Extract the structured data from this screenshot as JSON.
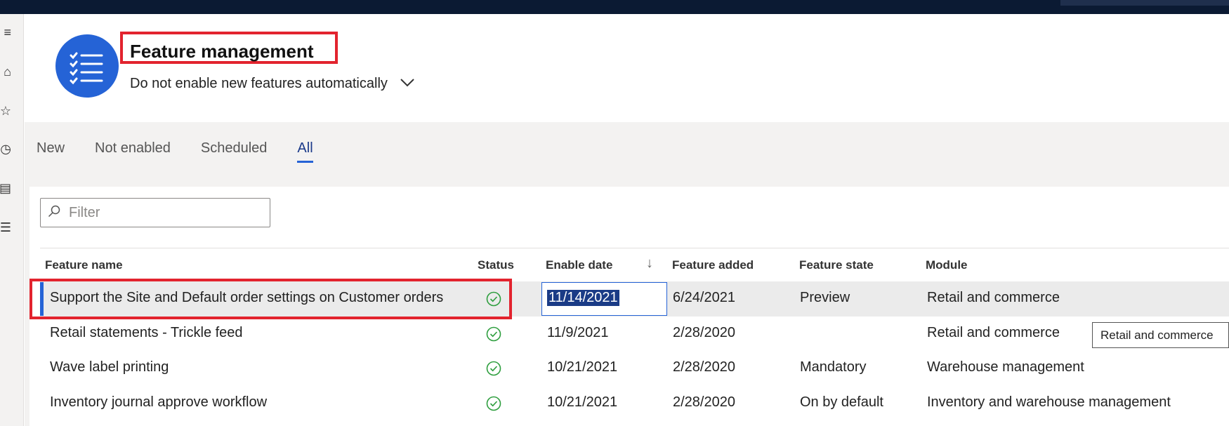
{
  "header": {
    "title": "Feature management",
    "auto_enable_option": "Do not enable new features automatically",
    "logo_icon": "checklist-icon"
  },
  "tabs": [
    {
      "label": "New",
      "active": false
    },
    {
      "label": "Not enabled",
      "active": false
    },
    {
      "label": "Scheduled",
      "active": false
    },
    {
      "label": "All",
      "active": true
    }
  ],
  "filter": {
    "placeholder": "Filter",
    "icon": "search-icon"
  },
  "table": {
    "columns": [
      "Feature name",
      "Status",
      "Enable date",
      "Feature added",
      "Feature state",
      "Module"
    ],
    "sort_icon": "sort-down-arrow-icon",
    "rows": [
      {
        "name": "Support the Site and Default order settings on Customer orders",
        "status": "enabled",
        "enable_date": "11/14/2021",
        "feature_added": "6/24/2021",
        "feature_state": "Preview",
        "module": "Retail and commerce",
        "selected": true
      },
      {
        "name": "Retail statements - Trickle feed",
        "status": "enabled",
        "enable_date": "11/9/2021",
        "feature_added": "2/28/2020",
        "feature_state": "",
        "module": "Retail and commerce",
        "selected": false
      },
      {
        "name": "Wave label printing",
        "status": "enabled",
        "enable_date": "10/21/2021",
        "feature_added": "2/28/2020",
        "feature_state": "Mandatory",
        "module": "Warehouse management",
        "selected": false
      },
      {
        "name": "Inventory journal approve workflow",
        "status": "enabled",
        "enable_date": "10/21/2021",
        "feature_added": "2/28/2020",
        "feature_state": "On by default",
        "module": "Inventory and warehouse management",
        "selected": false
      }
    ]
  },
  "tooltip": {
    "text": "Retail and commerce"
  },
  "colors": {
    "accent": "#2563d6",
    "highlight_box": "#e2232e",
    "status_ok": "#2e9e3e",
    "topbar": "#0b1a33"
  }
}
